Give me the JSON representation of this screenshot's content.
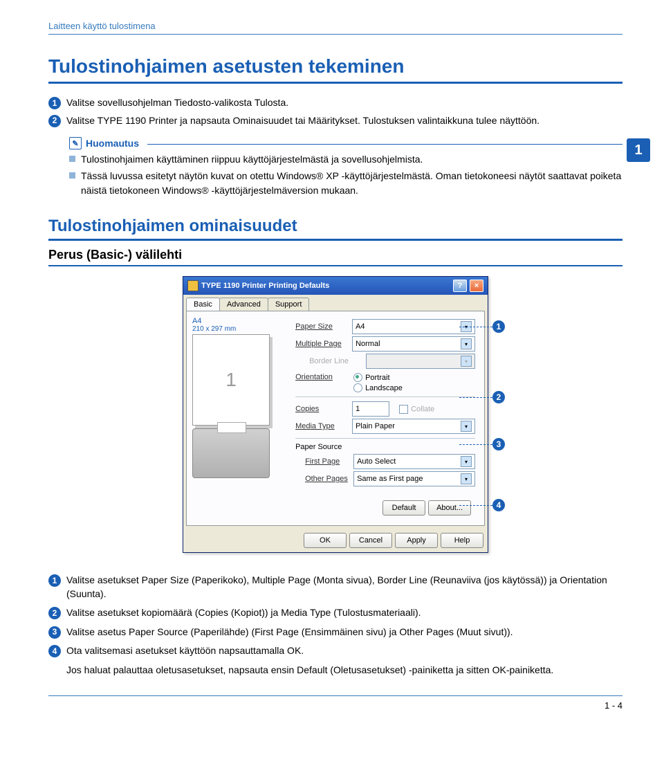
{
  "header": "Laitteen käyttö tulostimena",
  "chapter_number": "1",
  "h1": "Tulostinohjaimen asetusten tekeminen",
  "steps_top": [
    {
      "n": "1",
      "text": "Valitse sovellusohjelman Tiedosto-valikosta Tulosta."
    },
    {
      "n": "2",
      "text": "Valitse TYPE 1190 Printer ja napsauta Ominaisuudet tai Määritykset. Tulostuksen valintaikkuna tulee näyttöön."
    }
  ],
  "note": {
    "title": "Huomautus",
    "items": [
      "Tulostinohjaimen käyttäminen riippuu käyttöjärjestelmästä ja sovellusohjelmista.",
      "Tässä luvussa esitetyt näytön kuvat on otettu Windows® XP -käyttöjärjestelmästä. Oman tietokoneesi näytöt saattavat poiketa näistä tietokoneen Windows® -käyttöjärjestelmäversion mukaan."
    ]
  },
  "h2": "Tulostinohjaimen ominaisuudet",
  "h3": "Perus (Basic-) välilehti",
  "dialog": {
    "title": "TYPE 1190 Printer Printing Defaults",
    "tabs": [
      "Basic",
      "Advanced",
      "Support"
    ],
    "preview_label": "A4",
    "preview_sub": "210 x 297 mm",
    "preview_page": "1",
    "fields": {
      "paper_size_label": "Paper Size",
      "paper_size_value": "A4",
      "multiple_page_label": "Multiple Page",
      "multiple_page_value": "Normal",
      "border_line_label": "Border Line",
      "orientation_label": "Orientation",
      "orientation_portrait": "Portrait",
      "orientation_landscape": "Landscape",
      "copies_label": "Copies",
      "copies_value": "1",
      "collate_label": "Collate",
      "media_type_label": "Media Type",
      "media_type_value": "Plain Paper",
      "paper_source_label": "Paper Source",
      "first_page_label": "First Page",
      "first_page_value": "Auto Select",
      "other_pages_label": "Other Pages",
      "other_pages_value": "Same as First page"
    },
    "upper_buttons": {
      "default": "Default",
      "about": "About..."
    },
    "buttons": {
      "ok": "OK",
      "cancel": "Cancel",
      "apply": "Apply",
      "help": "Help"
    }
  },
  "callouts": {
    "c1": "1",
    "c2": "2",
    "c3": "3",
    "c4": "4"
  },
  "desc": [
    {
      "n": "1",
      "text": "Valitse asetukset Paper Size (Paperikoko), Multiple Page (Monta sivua), Border Line (Reunaviiva (jos käytössä)) ja Orientation (Suunta)."
    },
    {
      "n": "2",
      "text": "Valitse asetukset kopiomäärä (Copies (Kopiot)) ja Media Type (Tulostusmateriaali)."
    },
    {
      "n": "3",
      "text": "Valitse asetus Paper Source (Paperilähde) (First Page (Ensimmäinen sivu) ja Other Pages (Muut sivut))."
    },
    {
      "n": "4",
      "text": "Ota valitsemasi asetukset käyttöön napsauttamalla OK."
    },
    {
      "n": "",
      "text": "Jos haluat palauttaa oletusasetukset, napsauta ensin Default (Oletusasetukset) -painiketta ja sitten OK-painiketta."
    }
  ],
  "footer": "1 - 4"
}
